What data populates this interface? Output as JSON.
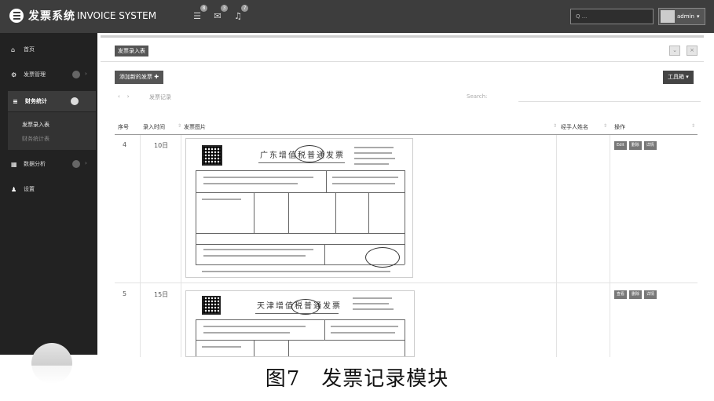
{
  "header": {
    "title_cn": "发票系统",
    "title_en": "INVOICE SYSTEM",
    "notifications": [
      {
        "icon": "list-icon",
        "count": "8"
      },
      {
        "icon": "mail-icon",
        "count": "3"
      },
      {
        "icon": "bell-icon",
        "count": "7"
      }
    ],
    "search_placeholder": "Q ...",
    "user": "admin"
  },
  "sidebar": {
    "items": [
      {
        "label": "首页",
        "icon": "home-icon"
      },
      {
        "label": "发票管理",
        "icon": "gears-icon"
      },
      {
        "label": "财务统计",
        "icon": "bars-icon"
      },
      {
        "label": "数据分析",
        "icon": "chart-icon"
      },
      {
        "label": "设置",
        "icon": "user-icon"
      }
    ],
    "sub_items": [
      "发票录入表",
      "财务统计表"
    ]
  },
  "main": {
    "breadcrumb": "发票录入表",
    "add_button": "添加新的发票 ✚",
    "tools_button": "工具箱 ▾",
    "pager": [
      "‹",
      "›"
    ],
    "pager_text": "发票记录",
    "search_label": "Search:",
    "columns": [
      "序号",
      "录入时间",
      "发票图片",
      "经手人姓名",
      "操作"
    ],
    "rows": [
      {
        "index": "4",
        "time": "10日",
        "invoice_title": "广东增值税普通发票",
        "actions": [
          "Edit",
          "删除",
          "详情"
        ]
      },
      {
        "index": "5",
        "time": "15日",
        "invoice_title": "天津增值税普通发票",
        "actions": [
          "查看",
          "删除",
          "详情"
        ]
      }
    ]
  },
  "caption": "图7　发票记录模块"
}
